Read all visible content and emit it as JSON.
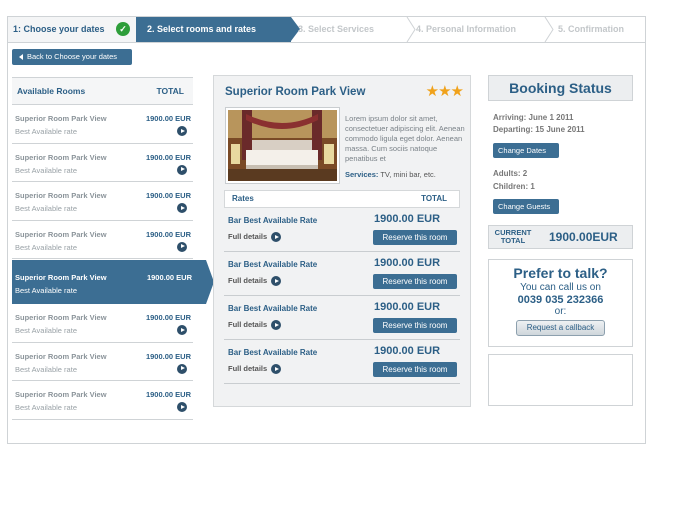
{
  "steps": {
    "step1": "1: Choose your dates",
    "step2": "2. Select rooms and rates",
    "step3": "3. Select Services",
    "step4": "4. Personal Information",
    "step5": "5. Confirmation"
  },
  "back_button": "Back to Choose your dates",
  "rooms_list": {
    "header": "Available Rooms",
    "total_header": "TOTAL",
    "items": [
      {
        "name": "Superior Room Park View",
        "rate": "Best Available rate",
        "price": "1900.00 EUR"
      },
      {
        "name": "Superior Room Park View",
        "rate": "Best Available rate",
        "price": "1900.00 EUR"
      },
      {
        "name": "Superior Room Park View",
        "rate": "Best Available rate",
        "price": "1900.00 EUR"
      },
      {
        "name": "Superior Room Park View",
        "rate": "Best Available rate",
        "price": "1900.00 EUR"
      },
      {
        "name": "Superior Room Park View",
        "rate": "Best Available rate",
        "price": "1900.00 EUR"
      },
      {
        "name": "Superior Room Park View",
        "rate": "Best Available rate",
        "price": "1900.00 EUR"
      },
      {
        "name": "Superior Room Park View",
        "rate": "Best Available rate",
        "price": "1900.00 EUR"
      },
      {
        "name": "Superior Room Park View",
        "rate": "Best Available rate",
        "price": "1900.00 EUR"
      }
    ],
    "selected_index": 4
  },
  "room_detail": {
    "title": "Superior Room Park View",
    "stars": 3,
    "stars_text": "★★★",
    "description": "Lorem ipsum dolor sit amet, consectetuer adipiscing elit. Aenean commodo ligula eget dolor. Aenean massa. Cum sociis natoque penatibus et",
    "services_label": "Services:",
    "services_value": "TV, mini bar, etc.",
    "rates_header": "Rates",
    "total_header": "TOTAL",
    "rates": [
      {
        "name": "Bar Best Available Rate",
        "details": "Full details",
        "price": "1900.00 EUR",
        "button": "Reserve this room"
      },
      {
        "name": "Bar Best Available Rate",
        "details": "Full details",
        "price": "1900.00 EUR",
        "button": "Reserve this room"
      },
      {
        "name": "Bar Best Available Rate",
        "details": "Full details",
        "price": "1900.00 EUR",
        "button": "Reserve this room"
      },
      {
        "name": "Bar Best Available Rate",
        "details": "Full details",
        "price": "1900.00 EUR",
        "button": "Reserve this room"
      }
    ]
  },
  "booking_status": {
    "title": "Booking Status",
    "arriving": "Arriving: June 1 2011",
    "departing": "Departing: 15 June 2011",
    "change_dates": "Change Dates",
    "adults": "Adults: 2",
    "children": "Children: 1",
    "change_guests": "Change Guests",
    "current_total_label_1": "CURRENT",
    "current_total_label_2": "TOTAL",
    "current_total_value": "1900.00EUR"
  },
  "talk": {
    "title": "Prefer to talk?",
    "subtitle": "You can call us on",
    "phone": "0039 035 232366",
    "or": "or:",
    "callback": "Request a callback"
  },
  "colors": {
    "primary": "#3c6e93",
    "text_blue": "#2c5f86",
    "star": "#f0a21b",
    "check": "#2e9e3a"
  }
}
